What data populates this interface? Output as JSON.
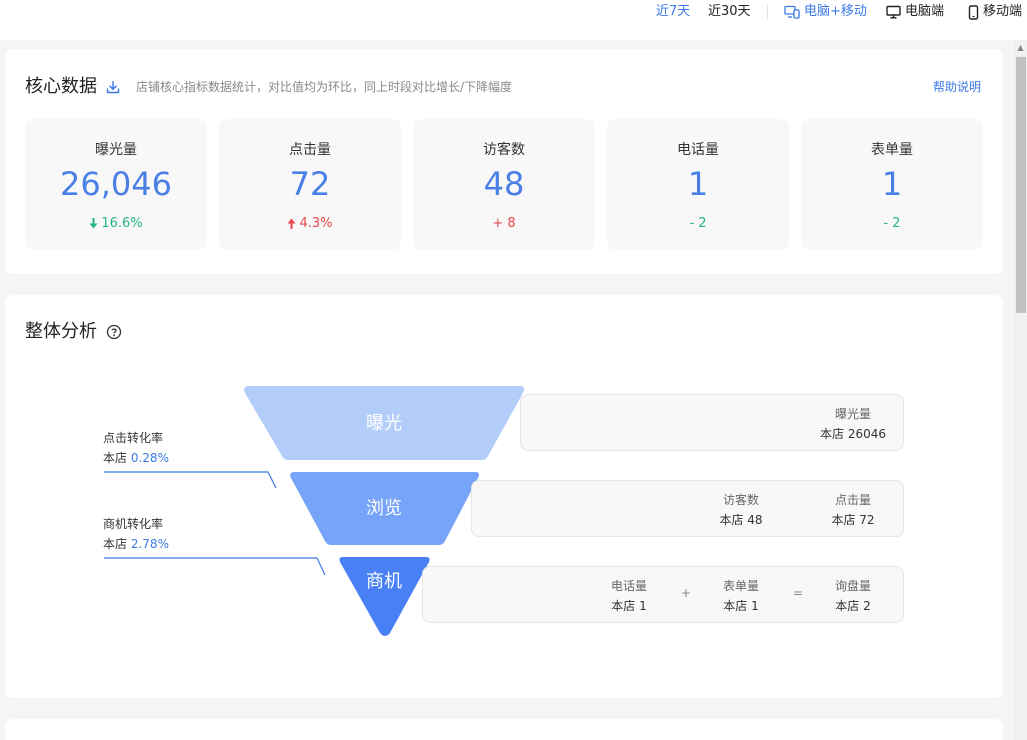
{
  "topbar": {
    "range_7": "近7天",
    "range_30": "近30天",
    "device_all": "电脑+移动",
    "device_pc": "电脑端",
    "device_mobile": "移动端"
  },
  "core": {
    "title": "核心数据",
    "desc": "店铺核心指标数据统计，对比值均为环比，同上时段对比增长/下降幅度",
    "help": "帮助说明",
    "metrics": [
      {
        "label": "曝光量",
        "value": "26,046",
        "change": "16.6%",
        "trend": "down"
      },
      {
        "label": "点击量",
        "value": "72",
        "change": "4.3%",
        "trend": "up"
      },
      {
        "label": "访客数",
        "value": "48",
        "change": "+ 8",
        "trend": "up"
      },
      {
        "label": "电话量",
        "value": "1",
        "change": "- 2",
        "trend": "down"
      },
      {
        "label": "表单量",
        "value": "1",
        "change": "- 2",
        "trend": "down"
      }
    ]
  },
  "analysis": {
    "title": "整体分析",
    "funnel": {
      "stage1": "曝光",
      "stage2": "浏览",
      "stage3": "商机",
      "stage_colors": [
        "#b3cdfb",
        "#77a3f8",
        "#4a80f5"
      ]
    },
    "rates": {
      "click_label": "点击转化率",
      "click_prefix": "本店",
      "click_value": "0.28%",
      "lead_label": "商机转化率",
      "lead_prefix": "本店",
      "lead_value": "2.78%"
    },
    "row1": {
      "exposure_label": "曝光量",
      "exposure_value": "本店 26046"
    },
    "row2": {
      "visitors_label": "访客数",
      "visitors_value": "本店 48",
      "clicks_label": "点击量",
      "clicks_value": "本店 72"
    },
    "row3": {
      "phone_label": "电话量",
      "phone_value": "本店 1",
      "plus": "+",
      "form_label": "表单量",
      "form_value": "本店 1",
      "equals": "=",
      "inquiry_label": "询盘量",
      "inquiry_value": "本店 2"
    }
  },
  "colors": {
    "accent": "#3b7ae8",
    "up": "#e8484d",
    "down": "#24b386"
  }
}
